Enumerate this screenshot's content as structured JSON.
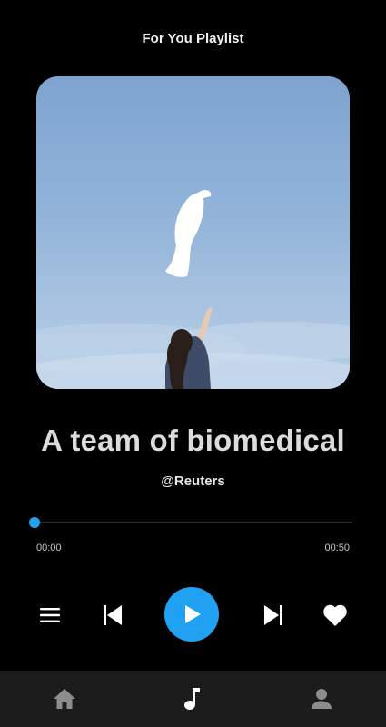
{
  "header": {
    "title": "For You Playlist"
  },
  "track": {
    "title": "A team of biomedical",
    "artist": "@Reuters",
    "progress": 0.0
  },
  "times": {
    "current": "00:00",
    "total": "00:50"
  },
  "colors": {
    "accent": "#21a1f1",
    "background": "#000000",
    "nav_background": "#1c1c1c"
  },
  "controls": {
    "menu_icon": "hamburger-menu-icon",
    "prev_icon": "skip-previous-icon",
    "play_icon": "play-icon",
    "next_icon": "skip-next-icon",
    "favorite_icon": "heart-icon"
  },
  "bottom_nav": [
    {
      "id": "home",
      "icon": "home-icon",
      "active": false
    },
    {
      "id": "music",
      "icon": "music-note-icon",
      "active": true
    },
    {
      "id": "profile",
      "icon": "person-icon",
      "active": false
    }
  ]
}
